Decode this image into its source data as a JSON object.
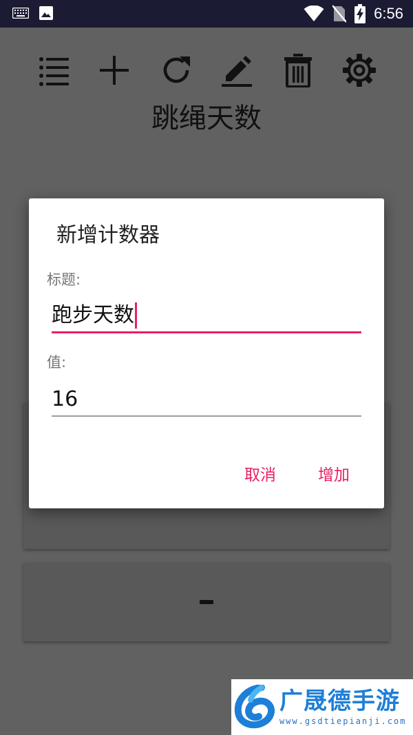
{
  "status_bar": {
    "time": "6:56",
    "icons": [
      "keyboard-icon",
      "image-icon",
      "wifi-icon",
      "no-sim-icon",
      "battery-charging-icon"
    ]
  },
  "toolbar": {
    "icons": [
      "menu-list-icon",
      "add-icon",
      "refresh-icon",
      "edit-icon",
      "delete-icon",
      "settings-icon"
    ]
  },
  "counter": {
    "title": "跳绳天数"
  },
  "dialog": {
    "title": "新增计数器",
    "title_label": "标题:",
    "title_value": "跑步天数",
    "value_label": "值:",
    "value_value": "16",
    "cancel_label": "取消",
    "add_label": "增加"
  },
  "watermark": {
    "text": "广晟德手游",
    "url": "www.gsdtiepianji.com"
  },
  "colors": {
    "accent": "#e91e63",
    "status_bar": "#1b1b33",
    "scrim_background": "#616161",
    "card": "#595959",
    "watermark_blue": "#1e7fd8"
  }
}
